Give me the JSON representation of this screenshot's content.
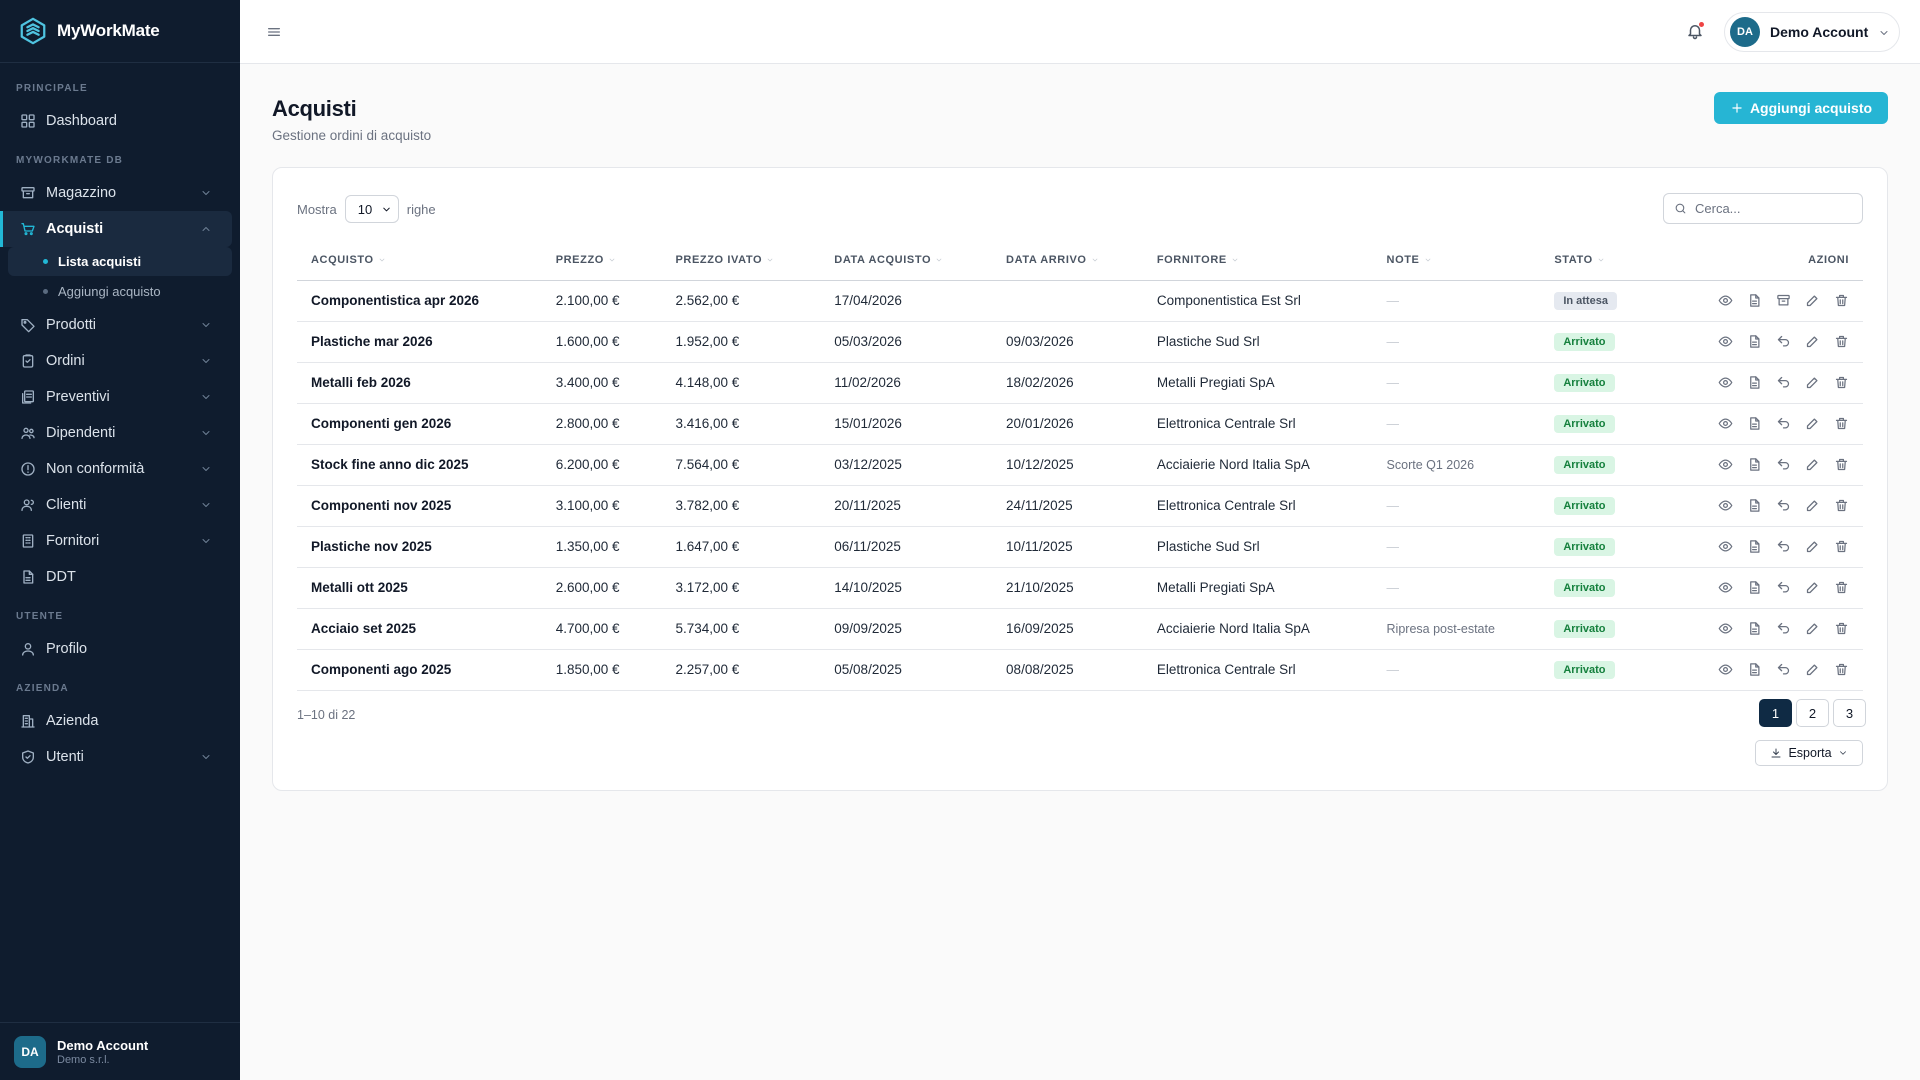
{
  "brand": {
    "name": "MyWorkMate"
  },
  "sidebar": {
    "sections": [
      {
        "label": "PRINCIPALE"
      },
      {
        "label": "MYWORKMATE DB"
      },
      {
        "label": "UTENTE"
      },
      {
        "label": "AZIENDA"
      }
    ],
    "items": [
      {
        "label": "Dashboard",
        "icon": "grid-icon"
      },
      {
        "label": "Magazzino",
        "icon": "archive-icon"
      },
      {
        "label": "Acquisti",
        "icon": "cart-icon",
        "active": true
      },
      {
        "label": "Prodotti",
        "icon": "tag-icon"
      },
      {
        "label": "Ordini",
        "icon": "clipboard-icon"
      },
      {
        "label": "Preventivi",
        "icon": "files-icon"
      },
      {
        "label": "Dipendenti",
        "icon": "users-icon"
      },
      {
        "label": "Non conformità",
        "icon": "alert-circle-icon"
      },
      {
        "label": "Clienti",
        "icon": "user-group-icon"
      },
      {
        "label": "Fornitori",
        "icon": "building-icon"
      },
      {
        "label": "DDT",
        "icon": "document-icon"
      },
      {
        "label": "Profilo",
        "icon": "user-icon"
      },
      {
        "label": "Azienda",
        "icon": "company-icon"
      },
      {
        "label": "Utenti",
        "icon": "shield-icon"
      }
    ],
    "subitems": [
      {
        "label": "Lista acquisti",
        "active": true
      },
      {
        "label": "Aggiungi acquisto"
      }
    ],
    "footer": {
      "initials": "DA",
      "name": "Demo Account",
      "company": "Demo s.r.l."
    }
  },
  "topbar": {
    "initials": "DA",
    "account_name": "Demo Account"
  },
  "page": {
    "title": "Acquisti",
    "subtitle": "Gestione ordini di acquisto",
    "add_button": "Aggiungi acquisto"
  },
  "controls": {
    "show_label": "Mostra",
    "rows_value": "10",
    "rows_label": "righe",
    "search_placeholder": "Cerca..."
  },
  "table": {
    "headers": [
      "ACQUISTO",
      "PREZZO",
      "PREZZO IVATO",
      "DATA ACQUISTO",
      "DATA ARRIVO",
      "FORNITORE",
      "NOTE",
      "STATO",
      "AZIONI"
    ],
    "rows": [
      {
        "name": "Componentistica apr 2026",
        "price": "2.100,00 €",
        "price_vat": "2.562,00 €",
        "purchase_date": "17/04/2026",
        "arrival_date": "",
        "supplier": "Componentistica Est Srl",
        "note": "—",
        "status": "In attesa",
        "status_kind": "wait"
      },
      {
        "name": "Plastiche mar 2026",
        "price": "1.600,00 €",
        "price_vat": "1.952,00 €",
        "purchase_date": "05/03/2026",
        "arrival_date": "09/03/2026",
        "supplier": "Plastiche Sud Srl",
        "note": "—",
        "status": "Arrivato",
        "status_kind": "ok"
      },
      {
        "name": "Metalli feb 2026",
        "price": "3.400,00 €",
        "price_vat": "4.148,00 €",
        "purchase_date": "11/02/2026",
        "arrival_date": "18/02/2026",
        "supplier": "Metalli Pregiati SpA",
        "note": "—",
        "status": "Arrivato",
        "status_kind": "ok"
      },
      {
        "name": "Componenti gen 2026",
        "price": "2.800,00 €",
        "price_vat": "3.416,00 €",
        "purchase_date": "15/01/2026",
        "arrival_date": "20/01/2026",
        "supplier": "Elettronica Centrale Srl",
        "note": "—",
        "status": "Arrivato",
        "status_kind": "ok"
      },
      {
        "name": "Stock fine anno dic 2025",
        "price": "6.200,00 €",
        "price_vat": "7.564,00 €",
        "purchase_date": "03/12/2025",
        "arrival_date": "10/12/2025",
        "supplier": "Acciaierie Nord Italia SpA",
        "note": "Scorte Q1 2026",
        "status": "Arrivato",
        "status_kind": "ok"
      },
      {
        "name": "Componenti nov 2025",
        "price": "3.100,00 €",
        "price_vat": "3.782,00 €",
        "purchase_date": "20/11/2025",
        "arrival_date": "24/11/2025",
        "supplier": "Elettronica Centrale Srl",
        "note": "—",
        "status": "Arrivato",
        "status_kind": "ok"
      },
      {
        "name": "Plastiche nov 2025",
        "price": "1.350,00 €",
        "price_vat": "1.647,00 €",
        "purchase_date": "06/11/2025",
        "arrival_date": "10/11/2025",
        "supplier": "Plastiche Sud Srl",
        "note": "—",
        "status": "Arrivato",
        "status_kind": "ok"
      },
      {
        "name": "Metalli ott 2025",
        "price": "2.600,00 €",
        "price_vat": "3.172,00 €",
        "purchase_date": "14/10/2025",
        "arrival_date": "21/10/2025",
        "supplier": "Metalli Pregiati SpA",
        "note": "—",
        "status": "Arrivato",
        "status_kind": "ok"
      },
      {
        "name": "Acciaio set 2025",
        "price": "4.700,00 €",
        "price_vat": "5.734,00 €",
        "purchase_date": "09/09/2025",
        "arrival_date": "16/09/2025",
        "supplier": "Acciaierie Nord Italia SpA",
        "note": "Ripresa post-estate",
        "status": "Arrivato",
        "status_kind": "ok"
      },
      {
        "name": "Componenti ago 2025",
        "price": "1.850,00 €",
        "price_vat": "2.257,00 €",
        "purchase_date": "05/08/2025",
        "arrival_date": "08/08/2025",
        "supplier": "Elettronica Centrale Srl",
        "note": "—",
        "status": "Arrivato",
        "status_kind": "ok"
      }
    ]
  },
  "footer": {
    "count": "1–10 di 22",
    "pages": [
      "1",
      "2",
      "3"
    ],
    "export_label": "Esporta"
  },
  "colors": {
    "accent": "#26b5d4",
    "sidebar_bg": "#0f1c2e",
    "status_ok": "#15803d",
    "page_active": "#0f2a44"
  }
}
